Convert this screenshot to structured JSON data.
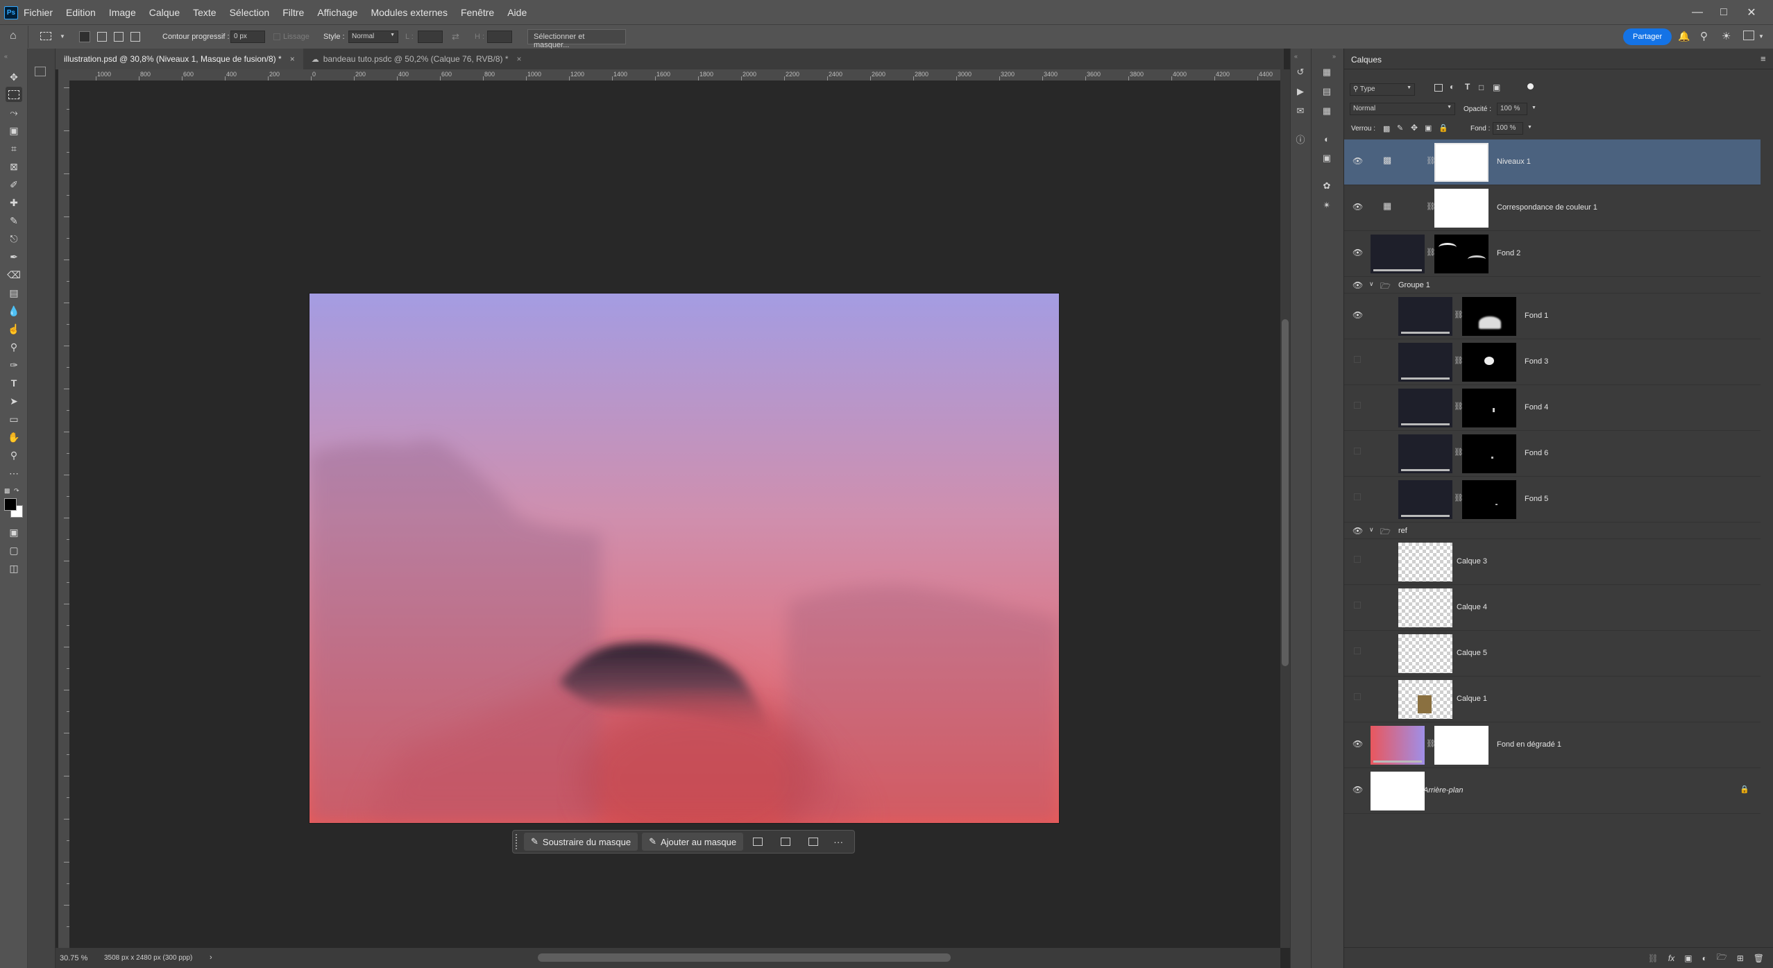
{
  "menu": {
    "logo": "Ps",
    "items": [
      "Fichier",
      "Edition",
      "Image",
      "Calque",
      "Texte",
      "Sélection",
      "Filtre",
      "Affichage",
      "Modules externes",
      "Fenêtre",
      "Aide"
    ]
  },
  "options": {
    "feather_label": "Contour progressif :",
    "feather_value": "0 px",
    "lissage": "Lissage",
    "style_label": "Style :",
    "style_value": "Normal",
    "l_label": "L :",
    "h_label": "H :",
    "select_mask_btn": "Sélectionner et masquer...",
    "share_btn": "Partager"
  },
  "tabs": [
    {
      "label": "illustration.psd @ 30,8% (Niveaux 1, Masque de fusion/8) *",
      "close": "×"
    },
    {
      "label": "bandeau tuto.psdc @ 50,2% (Calque 76, RVB/8) *",
      "close": "×"
    }
  ],
  "ruler_labels": [
    "1000",
    "800",
    "600",
    "400",
    "200",
    "0",
    "200",
    "400",
    "600",
    "800",
    "1000",
    "1200",
    "1400",
    "1600",
    "1800",
    "2000",
    "2200",
    "2400",
    "2600",
    "2800",
    "3000",
    "3200",
    "3400",
    "3600",
    "3800",
    "4000",
    "4200",
    "4400"
  ],
  "context_bar": {
    "subtract": "Soustraire du masque",
    "add": "Ajouter au masque",
    "more": "···"
  },
  "status": {
    "zoom": "30.75 %",
    "doc_info": "3508 px x 2480 px (300 ppp)",
    "arrow": "›"
  },
  "layers_panel": {
    "title": "Calques",
    "filter_value": "Type",
    "blend_mode": "Normal",
    "opacity_label": "Opacité :",
    "opacity_value": "100 %",
    "lock_label": "Verrou :",
    "fill_label": "Fond :",
    "fill_value": "100 %",
    "layers": [
      {
        "name": "Niveaux 1",
        "kind": "adjust-levels",
        "visible": true,
        "selected": true
      },
      {
        "name": "Correspondance de couleur 1",
        "kind": "adjust-color",
        "visible": true
      },
      {
        "name": "Fond 2",
        "kind": "masked",
        "visible": true
      },
      {
        "name": "Groupe 1",
        "kind": "group",
        "visible": true
      },
      {
        "name": "Fond 1",
        "kind": "masked-child",
        "visible": true
      },
      {
        "name": "Fond 3",
        "kind": "masked-child",
        "visible": false
      },
      {
        "name": "Fond 4",
        "kind": "masked-child",
        "visible": false
      },
      {
        "name": "Fond 6",
        "kind": "masked-child",
        "visible": false
      },
      {
        "name": "Fond 5",
        "kind": "masked-child",
        "visible": false
      },
      {
        "name": "ref",
        "kind": "group",
        "visible": true
      },
      {
        "name": "Calque 3",
        "kind": "pixel-child",
        "visible": false
      },
      {
        "name": "Calque 4",
        "kind": "pixel-child",
        "visible": false
      },
      {
        "name": "Calque 5",
        "kind": "pixel-child",
        "visible": false
      },
      {
        "name": "Calque 1",
        "kind": "pixel-child",
        "visible": false
      },
      {
        "name": "Fond en dégradé 1",
        "kind": "gradient",
        "visible": true
      },
      {
        "name": "Arrière-plan",
        "kind": "background",
        "visible": true
      }
    ]
  },
  "colors": {
    "sky_top": "#a49ce2",
    "sky_mid": "#cf8fae",
    "sky_bottom": "#ec5b58",
    "selected_layer": "#4b627f",
    "share": "#1473e6"
  }
}
